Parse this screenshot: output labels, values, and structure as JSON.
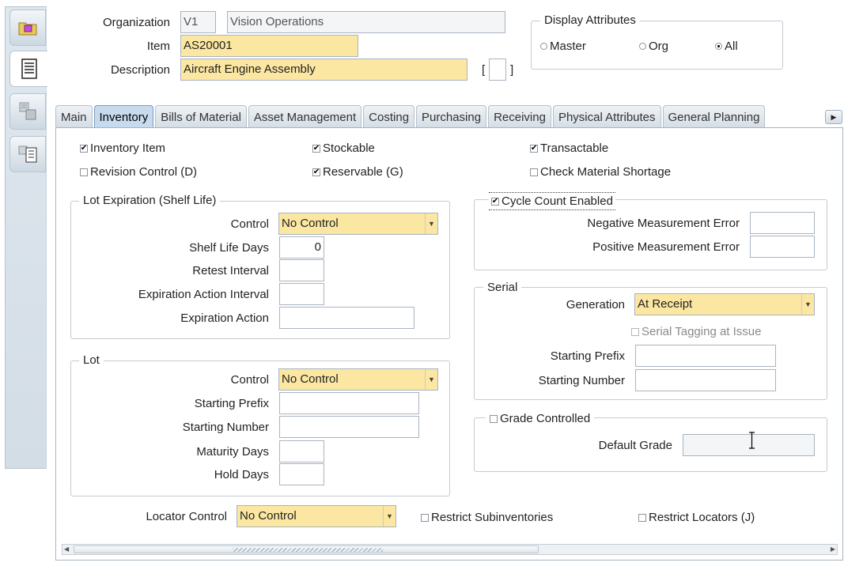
{
  "header": {
    "organization_label": "Organization",
    "organization_code": "V1",
    "organization_name": "Vision Operations",
    "item_label": "Item",
    "item_value": "AS20001",
    "description_label": "Description",
    "description_value": "Aircraft Engine Assembly",
    "bracket_open": "[",
    "bracket_close": "]"
  },
  "display_attributes": {
    "title": "Display Attributes",
    "options": [
      {
        "label": "Master",
        "selected": false
      },
      {
        "label": "Org",
        "selected": false
      },
      {
        "label": "All",
        "selected": true
      }
    ]
  },
  "tabs": [
    "Main",
    "Inventory",
    "Bills of Material",
    "Asset Management",
    "Costing",
    "Purchasing",
    "Receiving",
    "Physical Attributes",
    "General Planning"
  ],
  "active_tab": "Inventory",
  "flags": {
    "inventory_item": "Inventory Item",
    "stockable": "Stockable",
    "transactable": "Transactable",
    "revision_control": "Revision Control (D)",
    "reservable": "Reservable (G)",
    "check_material_shortage": "Check Material Shortage"
  },
  "lot_expiration": {
    "title": "Lot Expiration (Shelf Life)",
    "control_label": "Control",
    "control_value": "No Control",
    "shelf_life_days_label": "Shelf Life Days",
    "shelf_life_days_value": "0",
    "retest_interval_label": "Retest Interval",
    "expiration_action_interval_label": "Expiration Action Interval",
    "expiration_action_label": "Expiration Action"
  },
  "lot": {
    "title": "Lot",
    "control_label": "Control",
    "control_value": "No Control",
    "starting_prefix_label": "Starting Prefix",
    "starting_number_label": "Starting Number",
    "maturity_days_label": "Maturity Days",
    "hold_days_label": "Hold Days"
  },
  "cycle_count": {
    "title": "Cycle Count Enabled",
    "negative_label": "Negative Measurement Error",
    "positive_label": "Positive Measurement Error"
  },
  "serial": {
    "title": "Serial",
    "generation_label": "Generation",
    "generation_value": "At Receipt",
    "serial_tagging_label": "Serial Tagging at Issue",
    "starting_prefix_label": "Starting Prefix",
    "starting_number_label": "Starting Number"
  },
  "grade": {
    "title": "Grade Controlled",
    "default_grade_label": "Default Grade"
  },
  "locator": {
    "label": "Locator Control",
    "value": "No Control",
    "restrict_subinventories": "Restrict Subinventories",
    "restrict_locators": "Restrict Locators (J)"
  }
}
